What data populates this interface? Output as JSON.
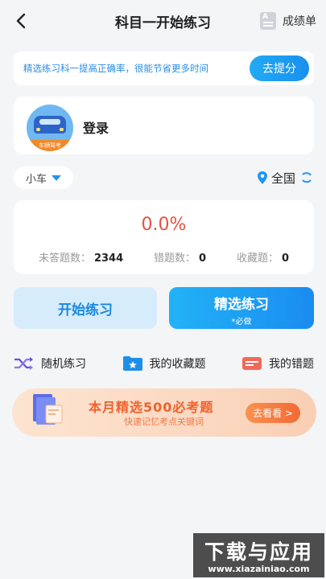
{
  "header": {
    "title": "科目一开始练习",
    "score_label": "成绩单"
  },
  "tip": {
    "text": "精选练习科一提高正确率，很能节省更多时间",
    "button": "去提分"
  },
  "user": {
    "name": "登录",
    "avatar_badge": "车辆驾考"
  },
  "filter": {
    "car_type": "小车",
    "region": "全国"
  },
  "stats": {
    "correct_rate": "0.0%",
    "unanswered_label": "未答题数：",
    "unanswered": "2344",
    "wrong_label": "错题数：",
    "wrong": "0",
    "favorite_label": "收藏题：",
    "favorite": "0"
  },
  "practice": {
    "start": "开始练习",
    "select": "精选练习",
    "select_sub": "*必做"
  },
  "quick": {
    "random": "随机练习",
    "favorites": "我的收藏题",
    "mistakes": "我的错题"
  },
  "banner": {
    "title": "本月精选500必考题",
    "subtitle": "快速记忆考点关键词",
    "button": "去看看 >"
  },
  "watermark": {
    "title": "下载与应用",
    "url": "www.xiazainiao.com"
  },
  "colors": {
    "accent": "#1a8cf0",
    "rate": "#e2533f",
    "banner_text": "#f0612d"
  }
}
